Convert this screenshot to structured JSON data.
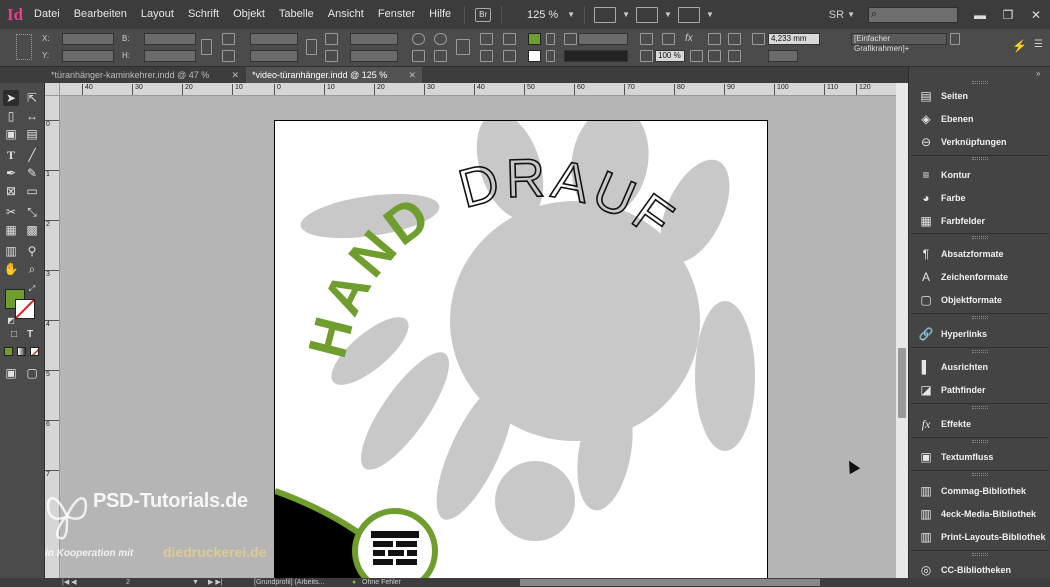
{
  "menu": {
    "items": [
      "Datei",
      "Bearbeiten",
      "Layout",
      "Schrift",
      "Objekt",
      "Tabelle",
      "Ansicht",
      "Fenster",
      "Hilfe"
    ],
    "bridge_label": "Br",
    "zoom": "125 %",
    "workspace": "SR"
  },
  "control": {
    "x_label": "X:",
    "y_label": "Y:",
    "w_label": "B:",
    "h_label": "H:",
    "stroke_weight": "4,233 mm",
    "opacity": "100 %",
    "object_style": "[Einfacher Grafikrahmen]+"
  },
  "colors": {
    "accent_green": "#6f9d2e",
    "handprint": "#c6c6c6"
  },
  "tabs": [
    {
      "label": "*türanhänger-kaminkehrer.indd @ 47 %",
      "active": false
    },
    {
      "label": "*video-türanhänger.indd @ 125 %",
      "active": true
    }
  ],
  "ruler": {
    "h_ticks": [
      "40",
      "30",
      "20",
      "10",
      "0",
      "10",
      "20",
      "30",
      "40",
      "50",
      "60",
      "70",
      "80",
      "90",
      "100",
      "110",
      "120"
    ],
    "v_ticks": [
      "0",
      "1",
      "2",
      "3",
      "4",
      "5",
      "6",
      "7"
    ]
  },
  "document": {
    "word_hand": "HAND",
    "word_drauf": "DRAUF"
  },
  "panels": [
    {
      "label": "Seiten",
      "icon": "pages-icon"
    },
    {
      "label": "Ebenen",
      "icon": "layers-icon"
    },
    {
      "label": "Verknüpfungen",
      "icon": "links-icon"
    },
    {
      "label": "Kontur",
      "icon": "stroke-icon"
    },
    {
      "label": "Farbe",
      "icon": "color-icon"
    },
    {
      "label": "Farbfelder",
      "icon": "swatches-icon"
    },
    {
      "label": "Absatzformate",
      "icon": "paragraph-styles-icon"
    },
    {
      "label": "Zeichenformate",
      "icon": "character-styles-icon"
    },
    {
      "label": "Objektformate",
      "icon": "object-styles-icon"
    },
    {
      "label": "Hyperlinks",
      "icon": "hyperlinks-icon"
    },
    {
      "label": "Ausrichten",
      "icon": "align-icon"
    },
    {
      "label": "Pathfinder",
      "icon": "pathfinder-icon"
    },
    {
      "label": "Effekte",
      "icon": "effects-icon"
    },
    {
      "label": "Textumfluss",
      "icon": "text-wrap-icon"
    },
    {
      "label": "Commag-Bibliothek",
      "icon": "library-icon"
    },
    {
      "label": "4eck-Media-Bibliothek",
      "icon": "library-icon"
    },
    {
      "label": "Print-Layouts-Bibliothek",
      "icon": "library-icon"
    },
    {
      "label": "CC-Bibliotheken",
      "icon": "cc-libraries-icon"
    }
  ],
  "status": {
    "page": "2",
    "profile": "[Grundprofil] (Arbeits...",
    "preflight": "Ohne Fehler"
  },
  "watermark": {
    "main": "PSD-Tutorials.de",
    "sub": "in Kooperation mit",
    "brand": "diedruckerei.de"
  }
}
